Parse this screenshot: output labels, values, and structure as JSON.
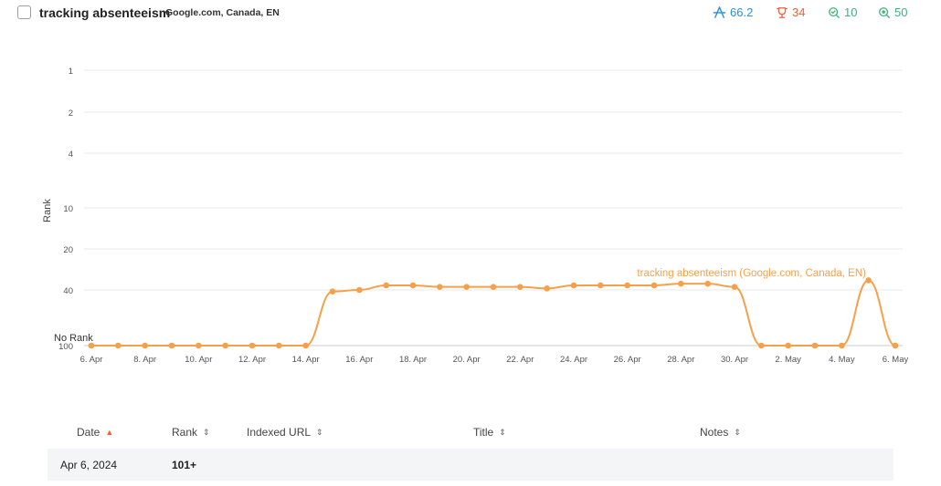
{
  "header": {
    "keyword": "tracking absenteeism",
    "location": "Google.com, Canada, EN",
    "metrics": [
      {
        "icon": "visibility-icon",
        "value": "66.2",
        "color": "#2a8fd6"
      },
      {
        "icon": "trophy-icon",
        "value": "34",
        "color": "#f0603c"
      },
      {
        "icon": "search-check-icon",
        "value": "10",
        "color": "#3db37a"
      },
      {
        "icon": "search-target-icon",
        "value": "50",
        "color": "#3db37a"
      }
    ]
  },
  "chart_data": {
    "type": "line",
    "ylabel": "Rank",
    "xlabel": "",
    "y_scale": "log",
    "y_reversed": true,
    "y_ticks": [
      "1",
      "2",
      "4",
      "10",
      "20",
      "40",
      "100"
    ],
    "y_tick_values": [
      1,
      2,
      4,
      10,
      20,
      40,
      100
    ],
    "no_rank_label": "No Rank",
    "x_ticks": [
      "6. Apr",
      "8. Apr",
      "10. Apr",
      "12. Apr",
      "14. Apr",
      "16. Apr",
      "18. Apr",
      "20. Apr",
      "22. Apr",
      "24. Apr",
      "26. Apr",
      "28. Apr",
      "30. Apr",
      "2. May",
      "4. May",
      "6. May"
    ],
    "x": [
      "Apr 6",
      "Apr 7",
      "Apr 8",
      "Apr 9",
      "Apr 10",
      "Apr 11",
      "Apr 12",
      "Apr 13",
      "Apr 14",
      "Apr 15",
      "Apr 16",
      "Apr 17",
      "Apr 18",
      "Apr 19",
      "Apr 20",
      "Apr 21",
      "Apr 22",
      "Apr 23",
      "Apr 24",
      "Apr 25",
      "Apr 26",
      "Apr 27",
      "Apr 28",
      "Apr 29",
      "Apr 30",
      "May 1",
      "May 2",
      "May 3",
      "May 4",
      "May 5",
      "May 6"
    ],
    "series": [
      {
        "name": "tracking absenteeism (Google.com, Canada, EN)",
        "color": "#f7a04a",
        "values": [
          100,
          100,
          100,
          100,
          100,
          100,
          100,
          100,
          100,
          41,
          40,
          37,
          37,
          38,
          38,
          38,
          38,
          39,
          37,
          37,
          37,
          37,
          36,
          36,
          38,
          100,
          100,
          100,
          100,
          34,
          100
        ]
      }
    ],
    "grid": true,
    "legend": "inline-label"
  },
  "table": {
    "columns": [
      {
        "label": "Date",
        "sort": "asc"
      },
      {
        "label": "Rank",
        "sort": "both"
      },
      {
        "label": "Indexed URL",
        "sort": "both"
      },
      {
        "label": "Title",
        "sort": "both"
      },
      {
        "label": "Notes",
        "sort": "both"
      }
    ],
    "rows": [
      {
        "date": "Apr 6, 2024",
        "rank": "101+",
        "url": "",
        "title": "",
        "notes": ""
      }
    ]
  }
}
